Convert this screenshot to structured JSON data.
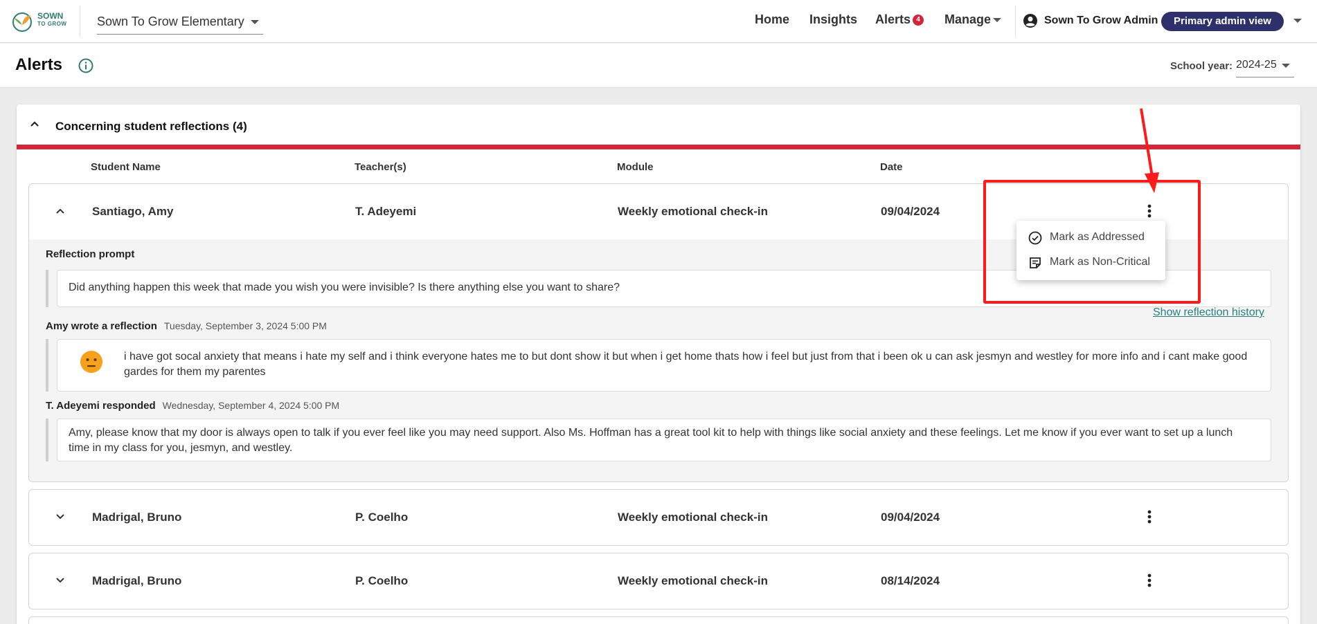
{
  "app": {
    "logo_text": "SOWN",
    "logo_sub": "TO GROW",
    "school": "Sown To Grow Elementary",
    "nav": [
      "Home",
      "Insights",
      "Alerts",
      "Manage"
    ],
    "alerts_count": "4",
    "user": "Sown To Grow Admin",
    "view_label": "Primary admin view"
  },
  "page": {
    "title": "Alerts",
    "school_year_label": "School year:",
    "school_year": "2024-25"
  },
  "section": {
    "title": "Concerning student reflections (4)",
    "columns": [
      "Student Name",
      "Teacher(s)",
      "Module",
      "Date"
    ]
  },
  "rows": [
    {
      "student": "Santiago, Amy",
      "teacher": "T. Adeyemi",
      "module": "Weekly emotional check-in",
      "date": "09/04/2024",
      "prompt_label": "Reflection prompt",
      "prompt": "Did anything happen this week that made you wish you were invisible? Is there anything else you want to share?",
      "reflection_label": "Amy wrote a reflection",
      "reflection_time": "Tuesday, September 3, 2024 5:00 PM",
      "history_link": "Show reflection history",
      "reflection": "i have got socal anxiety that means i hate my self and i think everyone hates me to but dont show it but when i get home thats how i feel but just from that i been ok u can ask jesmyn and westley for more info and i cant make good gardes for them my parentes",
      "response_label": "T. Adeyemi responded",
      "response_time": "Wednesday, September 4, 2024 5:00 PM",
      "response": "Amy, please know that my door is always open to talk if you ever feel like you may need support. Also Ms. Hoffman has a great tool kit to help with things like social anxiety and these feelings. Let me know if you ever want to set up a lunch time in my class for you, jesmyn, and westley."
    },
    {
      "student": "Madrigal, Bruno",
      "teacher": "P. Coelho",
      "module": "Weekly emotional check-in",
      "date": "09/04/2024"
    },
    {
      "student": "Madrigal, Bruno",
      "teacher": "P. Coelho",
      "module": "Weekly emotional check-in",
      "date": "08/14/2024"
    }
  ],
  "menu": {
    "items": [
      "Mark as Addressed",
      "Mark as Non-Critical"
    ]
  },
  "colors": {
    "alert_red": "#d0283a",
    "brand_navy": "#2e2f6b",
    "brand_green": "#2f7d6e",
    "annotation_red": "#ff1a1a"
  }
}
